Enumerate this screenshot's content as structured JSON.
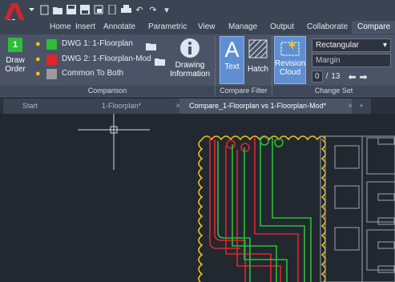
{
  "app": {
    "logo_text": "LT"
  },
  "quick_access": {
    "icons": [
      "new-icon",
      "open-icon",
      "save-icon",
      "save-as-icon",
      "plot-icon",
      "share-icon",
      "print-icon",
      "undo-icon",
      "redo-icon",
      "customize-icon"
    ]
  },
  "ribbon_tabs": [
    "Home",
    "Insert",
    "Annotate",
    "Parametric",
    "View",
    "Manage",
    "Output",
    "Collaborate",
    "Compare"
  ],
  "active_tab": "Compare",
  "comparison": {
    "draw_order_badge": "1",
    "draw_order_label1": "Draw",
    "draw_order_label2": "Order",
    "dwg1": "DWG 1:  1-Floorplan",
    "dwg2": "DWG 2:  1-Floorplan-Mod",
    "common": "Common To Both",
    "drawing_info1": "Drawing",
    "drawing_info2": "Information",
    "panel_title": "Comparison",
    "colors": {
      "dwg1": "#2dbd36",
      "dwg2": "#e3242b",
      "common": "#9b9b9b"
    }
  },
  "compare_filter": {
    "text_label": "Text",
    "hatch_label": "Hatch",
    "panel_title": "Compare Filter"
  },
  "change_set": {
    "revision1": "Revision",
    "revision2": "Cloud",
    "shape": "Rectangular",
    "margin_placeholder": "Margin",
    "counter_current": "0",
    "counter_sep": "/",
    "counter_total": "13",
    "panel_title": "Change Set"
  },
  "doc_tabs": [
    {
      "label": "Start",
      "close": ""
    },
    {
      "label": "1-Floorplan*",
      "close": "✕"
    },
    {
      "label": "Compare_1-Floorplan vs 1-Floorplan-Mod*",
      "close": "✕"
    }
  ],
  "new_tab_symbol": "+"
}
